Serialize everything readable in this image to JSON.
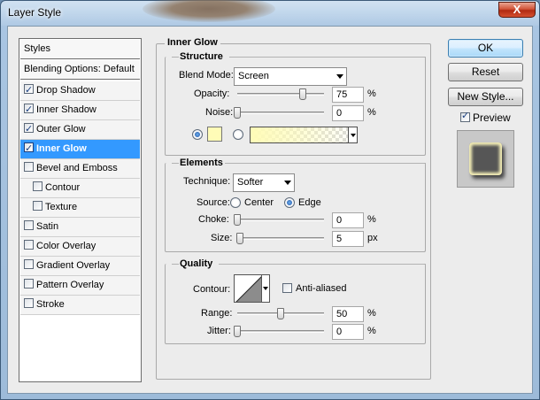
{
  "window": {
    "title": "Layer Style",
    "close": "X"
  },
  "styles_list": [
    {
      "label": "Styles",
      "header": true
    },
    {
      "label": "Blending Options: Default",
      "header": true
    },
    {
      "label": "Drop Shadow",
      "checked": true
    },
    {
      "label": "Inner Shadow",
      "checked": true
    },
    {
      "label": "Outer Glow",
      "checked": true
    },
    {
      "label": "Inner Glow",
      "checked": true,
      "selected": true
    },
    {
      "label": "Bevel and Emboss",
      "checked": false
    },
    {
      "label": "Contour",
      "checked": false,
      "indent": true
    },
    {
      "label": "Texture",
      "checked": false,
      "indent": true
    },
    {
      "label": "Satin",
      "checked": false
    },
    {
      "label": "Color Overlay",
      "checked": false
    },
    {
      "label": "Gradient Overlay",
      "checked": false
    },
    {
      "label": "Pattern Overlay",
      "checked": false
    },
    {
      "label": "Stroke",
      "checked": false
    }
  ],
  "panel": {
    "title": "Inner Glow",
    "structure": {
      "title": "Structure",
      "blend_mode_label": "Blend Mode:",
      "blend_mode_value": "Screen",
      "opacity_label": "Opacity:",
      "opacity_value": "75",
      "opacity_fraction": 0.75,
      "opacity_unit": "%",
      "noise_label": "Noise:",
      "noise_value": "0",
      "noise_fraction": 0.0,
      "noise_unit": "%",
      "color_swatch": "#fffcb7",
      "color_mode": "solid"
    },
    "elements": {
      "title": "Elements",
      "technique_label": "Technique:",
      "technique_value": "Softer",
      "source_label": "Source:",
      "source_options": [
        "Center",
        "Edge"
      ],
      "source_selected": "Edge",
      "choke_label": "Choke:",
      "choke_value": "0",
      "choke_fraction": 0.0,
      "choke_unit": "%",
      "size_label": "Size:",
      "size_value": "5",
      "size_fraction": 0.02,
      "size_unit": "px"
    },
    "quality": {
      "title": "Quality",
      "contour_label": "Contour:",
      "anti_aliased_label": "Anti-aliased",
      "anti_aliased": false,
      "range_label": "Range:",
      "range_value": "50",
      "range_fraction": 0.5,
      "range_unit": "%",
      "jitter_label": "Jitter:",
      "jitter_value": "0",
      "jitter_fraction": 0.0,
      "jitter_unit": "%"
    }
  },
  "buttons": {
    "ok": "OK",
    "reset": "Reset",
    "new_style": "New Style..."
  },
  "preview": {
    "label": "Preview",
    "checked": true
  }
}
